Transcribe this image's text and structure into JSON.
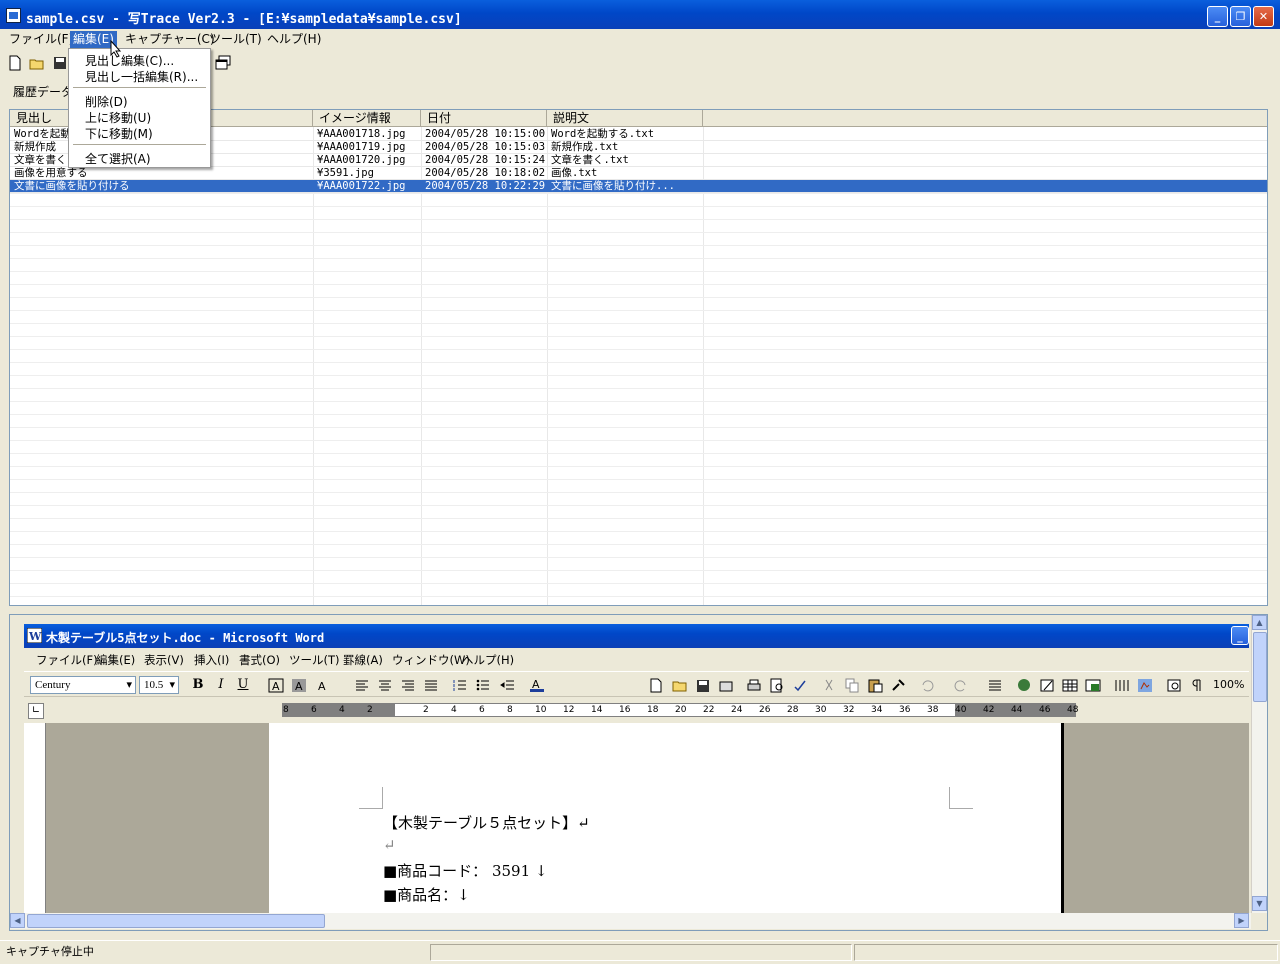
{
  "window": {
    "title": "sample.csv - 写Trace Ver2.3 - [E:¥sampledata¥sample.csv]",
    "min": "_",
    "restore": "❐",
    "close": "✕"
  },
  "menubar": {
    "file": "ファイル(F)",
    "edit": "編集(E)",
    "capture": "キャプチャー(C)",
    "tools": "ツール(T)",
    "help": "ヘルプ(H)"
  },
  "edit_menu": {
    "heading_edit": "見出し編集(C)...",
    "heading_bulk_edit": "見出し一括編集(R)...",
    "delete": "削除(D)",
    "move_up": "上に移動(U)",
    "move_down": "下に移動(M)",
    "select_all": "全て選択(A)"
  },
  "history": {
    "label": "履歴データ"
  },
  "list": {
    "columns": [
      "見出し",
      "イメージ情報",
      "日付",
      "説明文"
    ],
    "rows": [
      [
        "Wordを起動する",
        "¥AAA001718.jpg",
        "2004/05/28 10:15:00",
        "Wordを起動する.txt"
      ],
      [
        "新規作成",
        "¥AAA001719.jpg",
        "2004/05/28 10:15:03",
        "新規作成.txt"
      ],
      [
        "文章を書く",
        "¥AAA001720.jpg",
        "2004/05/28 10:15:24",
        "文章を書く.txt"
      ],
      [
        "画像を用意する",
        "¥3591.jpg",
        "2004/05/28 10:18:02",
        "画像.txt"
      ],
      [
        "文書に画像を貼り付ける",
        "¥AAA001722.jpg",
        "2004/05/28 10:22:29",
        "文書に画像を貼り付け..."
      ]
    ],
    "selected_index": 4
  },
  "word": {
    "title": "木製テーブル5点セット.doc - Microsoft Word",
    "menus": [
      "ファイル(F)",
      "編集(E)",
      "表示(V)",
      "挿入(I)",
      "書式(O)",
      "ツール(T)",
      "罫線(A)",
      "ウィンドウ(W)",
      "ヘルプ(H)"
    ],
    "font_name": "Century",
    "font_size": "10.5",
    "bold": "B",
    "italic": "I",
    "underline": "U",
    "zoom": "100%",
    "ruler_ticks": [
      "8",
      "6",
      "4",
      "2",
      "2",
      "4",
      "6",
      "8",
      "10",
      "12",
      "14",
      "16",
      "18",
      "20",
      "22",
      "24",
      "26",
      "28",
      "30",
      "32",
      "34",
      "36",
      "38",
      "40",
      "42",
      "44",
      "46",
      "48"
    ],
    "doc_lines": [
      "【木製テーブル５点セット】↵",
      "↵",
      "■商品コード： 3591 ↓",
      "■商品名：↓"
    ]
  },
  "status": {
    "text": "キャプチャ停止中"
  }
}
